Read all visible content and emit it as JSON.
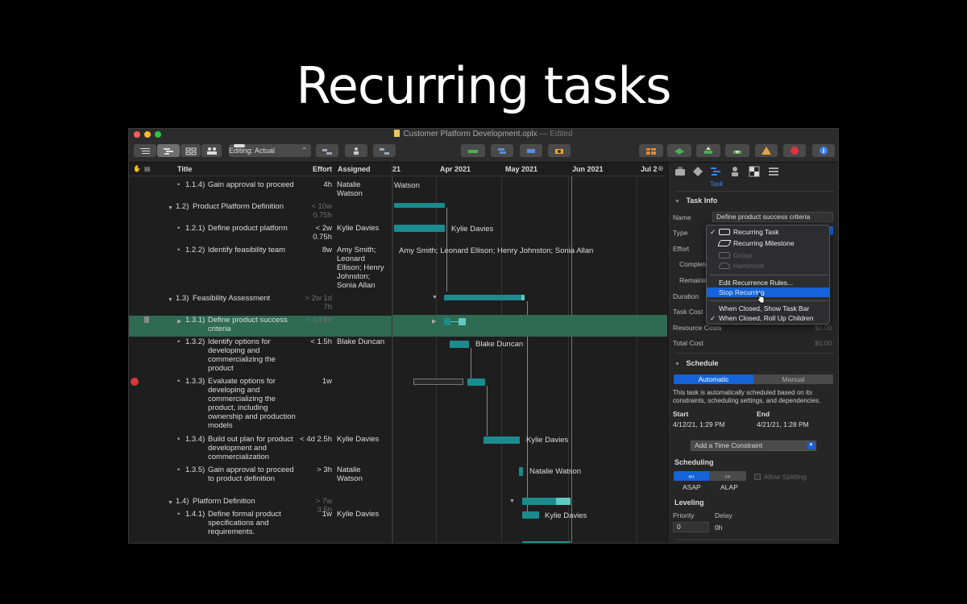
{
  "headline": "Recurring tasks",
  "window": {
    "title": "Customer Platform Development.oplx",
    "status": "— Edited"
  },
  "toolbar": {
    "editing_label": "Editing: Actual"
  },
  "outline": {
    "headers": {
      "title": "Title",
      "effort": "Effort",
      "assigned": "Assigned"
    },
    "rows": [
      {
        "id": "1.1.4)",
        "title": "Gain approval to proceed",
        "effort": "4h",
        "assigned": "Natalie Watson"
      },
      {
        "id": "1.2)",
        "title": "Product Platform Definition",
        "effort": "< 10w 0.75h",
        "assigned": ""
      },
      {
        "id": "1.2.1)",
        "title": "Define product platform",
        "effort": "< 2w 0.75h",
        "assigned": "Kylie Davies"
      },
      {
        "id": "1.2.2)",
        "title": "Identify feasibility team",
        "effort": "8w",
        "assigned": "Amy Smith; Leonard Ellison; Henry Johnston; Sonia Allan"
      },
      {
        "id": "1.3)",
        "title": "Feasibility Assessment",
        "effort": "> 2w 1d 7h",
        "assigned": ""
      },
      {
        "id": "1.3.1)",
        "title": "Define product success criteria",
        "effort": "< 1d 8h",
        "assigned": ""
      },
      {
        "id": "1.3.2)",
        "title": "Identify options for developing and commercializing the product",
        "effort": "< 1.5h",
        "assigned": "Blake Duncan"
      },
      {
        "id": "1.3.3)",
        "title": "Evaluate options for developing and commercializing the product, including ownership and production models",
        "effort": "1w",
        "assigned": ""
      },
      {
        "id": "1.3.4)",
        "title": "Build out plan for product development and commercialization",
        "effort": "< 4d 2.5h",
        "assigned": "Kylie Davies"
      },
      {
        "id": "1.3.5)",
        "title": "Gain approval to proceed to product definition",
        "effort": "> 3h",
        "assigned": "Natalie Watson"
      },
      {
        "id": "1.4)",
        "title": "Platform Definition",
        "effort": "> 7w 3.5h",
        "assigned": ""
      },
      {
        "id": "1.4.1)",
        "title": "Define formal product specifications and requirements.",
        "effort": "1w",
        "assigned": "Kylie Davies"
      }
    ]
  },
  "gantt": {
    "months": [
      "21",
      "Apr 2021",
      "May 2021",
      "Jun 2021",
      "Jul 2"
    ],
    "labels": {
      "r0": "Watson",
      "r2": "Kylie Davies",
      "r3": "Amy Smith; Leonard Ellison; Henry Johnston; Sonia Allan",
      "r6": "Blake Duncan",
      "r8": "Kylie Davies",
      "r9": "Natalie Watson",
      "r11": "Kylie Davies"
    }
  },
  "inspector": {
    "tab_label": "Task",
    "task_info": "Task Info",
    "name_label": "Name",
    "name_value": "Define product success criteria",
    "type_label": "Type",
    "effort_label": "Effort",
    "complete_label": "Complete",
    "remaining_label": "Remaining",
    "duration_label": "Duration",
    "task_cost_label": "Task Cost",
    "resource_costs_label": "Resource Costs",
    "resource_costs_value": "$0.00",
    "total_cost_label": "Total Cost",
    "total_cost_value": "$0.00",
    "schedule": "Schedule",
    "automatic": "Automatic",
    "manual": "Manual",
    "schedule_desc": "This task is automatically scheduled based on its constraints, scheduling settings, and dependencies.",
    "start_label": "Start",
    "start_value": "4/12/21, 1:29 PM",
    "end_label": "End",
    "end_value": "4/21/21, 1:28 PM",
    "add_constraint": "Add a Time Constraint",
    "scheduling": "Scheduling",
    "asap": "ASAP",
    "alap": "ALAP",
    "allow_splitting": "Allow Splitting",
    "leveling": "Leveling",
    "priority_label": "Priority",
    "priority_value": "0",
    "delay_label": "Delay",
    "delay_value": "0h"
  },
  "type_menu": {
    "recurring_task": "Recurring Task",
    "recurring_milestone": "Recurring Milestone",
    "group": "Group",
    "hammock": "Hammock",
    "edit_rules": "Edit Recurrence Rules...",
    "stop_recurring": "Stop Recurring",
    "when_closed_show": "When Closed, Show Task Bar",
    "when_closed_rollup": "When Closed, Roll Up Children"
  },
  "colors": {
    "accent": "#1463d8",
    "bar": "#1b8b8e",
    "selected_row": "#2e6b52"
  }
}
